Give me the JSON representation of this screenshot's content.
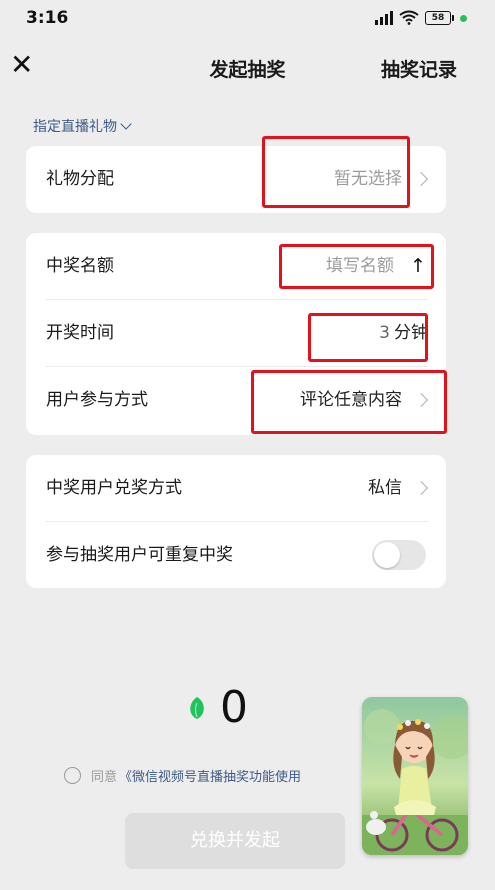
{
  "status_bar": {
    "time": "3:16",
    "battery": "58"
  },
  "nav": {
    "title": "发起抽奖",
    "right_link": "抽奖记录"
  },
  "gift_selector": {
    "label": "指定直播礼物"
  },
  "card1": {
    "gift_allocation": {
      "label": "礼物分配",
      "value": "暂无选择"
    }
  },
  "card2": {
    "winner_count": {
      "label": "中奖名额",
      "placeholder": "填写名额",
      "arrow": "↑"
    },
    "draw_time": {
      "label": "开奖时间",
      "value": "3",
      "unit": "分钟"
    },
    "participation": {
      "label": "用户参与方式",
      "value": "评论任意内容"
    }
  },
  "card3": {
    "redeem_method": {
      "label": "中奖用户兑奖方式",
      "value": "私信"
    },
    "repeat_win": {
      "label": "参与抽奖用户可重复中奖",
      "enabled": false
    }
  },
  "coins": {
    "count": "0"
  },
  "agreement": {
    "prefix": "同意",
    "link": "《微信视频号直播抽奖功能使用"
  },
  "submit": {
    "label": "兑换并发起"
  },
  "colors": {
    "highlight_red": "#e1121c",
    "link_blue": "#3f5a86",
    "coin_green": "#1fc35b"
  }
}
